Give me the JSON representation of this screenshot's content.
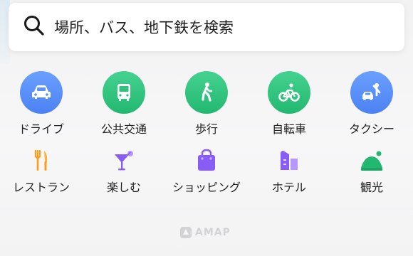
{
  "search": {
    "placeholder": "場所、バス、地下鉄を検索",
    "icon": "search-icon"
  },
  "transport": [
    {
      "label": "ドライブ",
      "icon": "car-icon",
      "color": "#4b82f2"
    },
    {
      "label": "公共交通",
      "icon": "bus-icon",
      "color": "#22b870"
    },
    {
      "label": "歩行",
      "icon": "walking-icon",
      "color": "#22b870"
    },
    {
      "label": "自転車",
      "icon": "bicycle-icon",
      "color": "#22b870"
    },
    {
      "label": "タクシー",
      "icon": "taxi-icon",
      "color": "#4b82f2"
    }
  ],
  "categories": [
    {
      "label": "レストラン",
      "icon": "fork-knife-icon",
      "color": "#ff9b1a"
    },
    {
      "label": "楽しむ",
      "icon": "cocktail-icon",
      "color": "#8a5cf6"
    },
    {
      "label": "ショッピング",
      "icon": "shopping-bag-icon",
      "color": "#8a5cf6"
    },
    {
      "label": "ホテル",
      "icon": "hotel-icon",
      "color": "#8a5cf6"
    },
    {
      "label": "観光",
      "icon": "sightseeing-icon",
      "color": "#22b870"
    }
  ],
  "footer": {
    "logo_text": "AMAP"
  }
}
